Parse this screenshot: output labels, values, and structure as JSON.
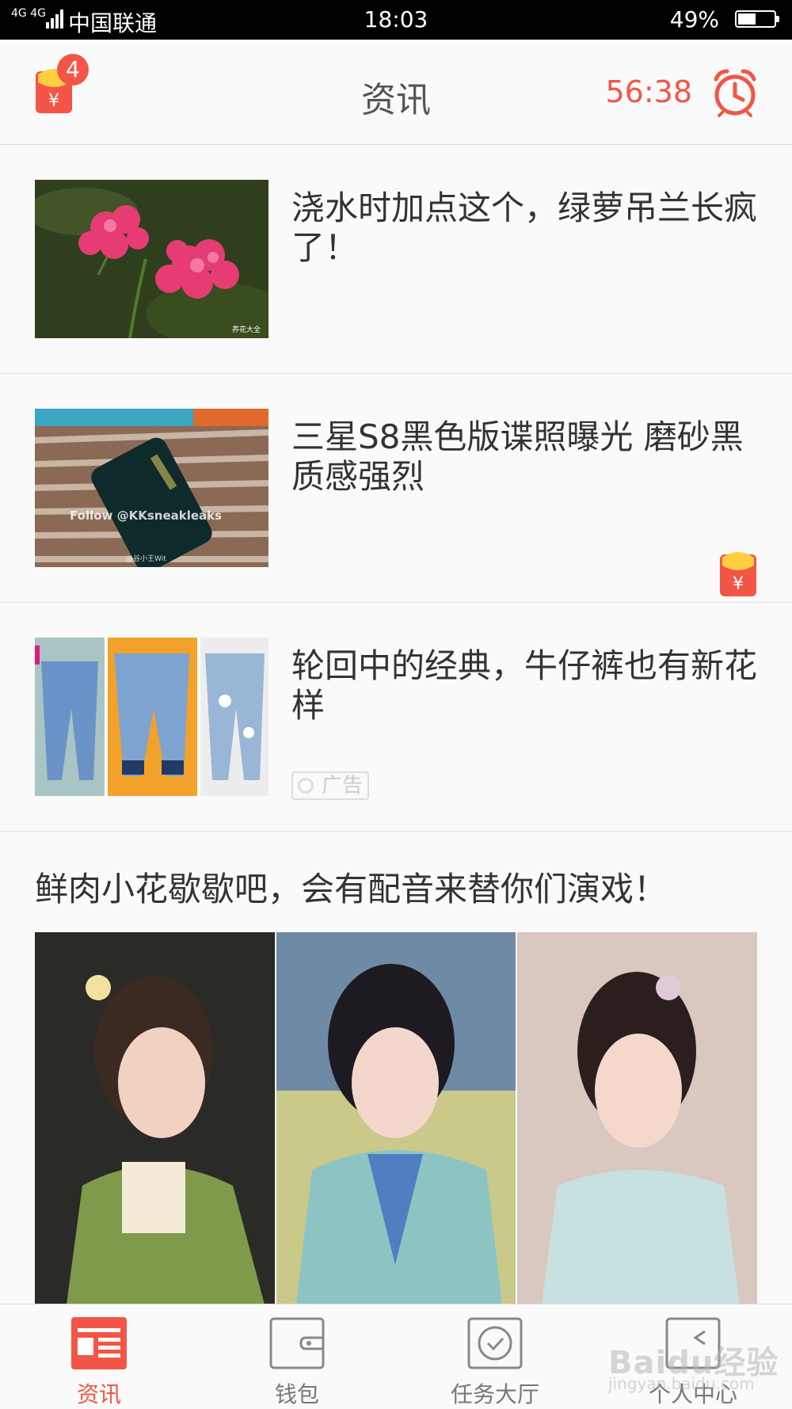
{
  "status_bar": {
    "signal_text": "4G 4G",
    "carrier": "中国联通",
    "time": "18:03",
    "battery_percent": "49%",
    "battery_level": 0.49
  },
  "header": {
    "title": "资讯",
    "red_packet_badge": "4",
    "countdown": "56:38",
    "icons": [
      "red-packet-icon",
      "alarm-clock-icon"
    ]
  },
  "feed": {
    "items": [
      {
        "title": "浇水时加点这个，绿萝吊兰长疯了！",
        "image_watermark": "养花大全",
        "has_red_packet": false
      },
      {
        "title": "三星S8黑色版谍照曝光 磨砂黑质感强烈",
        "image_caption": "Follow @KKsneakleaks",
        "image_watermark": "@谷小王Wit",
        "has_red_packet": true
      },
      {
        "title": "轮回中的经典，牛仔裤也有新花样",
        "ad_label": "广告"
      }
    ],
    "big_item": {
      "title": "鲜肉小花歇歇吧，会有配音来替你们演戏！"
    }
  },
  "tabbar": {
    "tabs": [
      {
        "label": "资讯",
        "icon": "news-icon",
        "active": true
      },
      {
        "label": "钱包",
        "icon": "wallet-icon",
        "active": false
      },
      {
        "label": "任务大厅",
        "icon": "task-check-icon",
        "active": false
      },
      {
        "label": "个人中心",
        "icon": "profile-icon",
        "active": false
      }
    ]
  },
  "watermark": {
    "text": "Baidu经验",
    "sub": "jingyan.baidu.com"
  },
  "colors": {
    "accent": "#f35546",
    "text": "#333333",
    "background": "#fafafa"
  }
}
